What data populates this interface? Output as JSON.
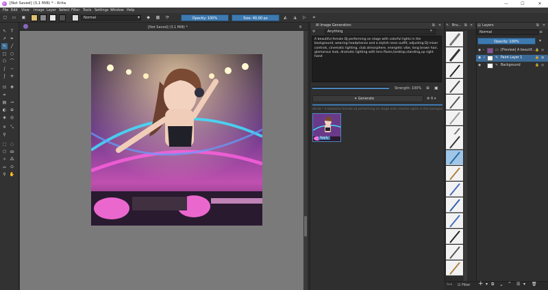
{
  "window": {
    "title": "[Not Saved]  (3,1 MiB) * - Krita",
    "min_glyph": "—",
    "max_glyph": "☐",
    "close_glyph": "✕"
  },
  "menu": [
    "File",
    "Edit",
    "View",
    "Image",
    "Layer",
    "Select",
    "Filter",
    "Tools",
    "Settings",
    "Window",
    "Help"
  ],
  "toolbar": {
    "blend_mode": "Normal",
    "opacity_label": "Opacity: 100%",
    "size_label": "Size: 40,00 px"
  },
  "document": {
    "tab_title": "[Not Saved]  (3,1 MiB) *",
    "close_glyph": "×"
  },
  "ai_panel": {
    "title": "AI Image Generation",
    "model": "Anything",
    "prompt": "A beautiful female DJ performing on stage with colorful lights in the background, wearing headphones and a stylish neon outfit, adjusting DJ mixer controls, cinematic lighting, club atmosphere, energetic vibe, long brown hair, glamorous look, dramatic lighting with lens flares,tanktop,standing,up right hand",
    "strength_label": "Strength: 100%",
    "strength_value": 100,
    "generate_label": "Generate",
    "batch_count": "6",
    "history_text": "06:00 - A beautiful female DJ performing on stage with colorful lights in the background",
    "apply_label": "Apply"
  },
  "brush_panel": {
    "title": "Bru..."
  },
  "layers_panel": {
    "title": "Layers",
    "blend_mode": "Normal",
    "opacity_label": "Opacity: 100%",
    "layers": [
      {
        "name": "[Preview] A beautif...",
        "selected": false
      },
      {
        "name": "Paint Layer 1",
        "selected": true
      },
      {
        "name": "Background",
        "selected": false
      }
    ],
    "filter_label": "Filter"
  },
  "colors": {
    "accent": "#3d7ab0",
    "selection": "#3b6a96",
    "panel_bg": "#2f2f2f",
    "canvas_bg": "#7a7a7a"
  }
}
